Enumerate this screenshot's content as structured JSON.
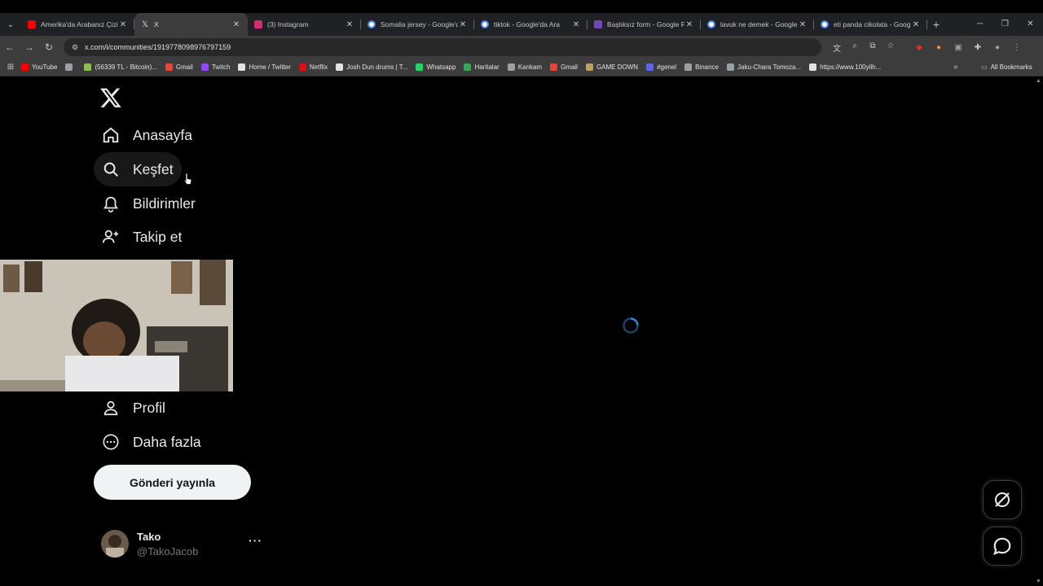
{
  "browser": {
    "tabs": [
      {
        "title": "Amerika'da Arabanız Çizil",
        "icon": "youtube-icon",
        "color": "#ff0000"
      },
      {
        "title": "X",
        "icon": "x-icon",
        "color": "#000000",
        "active": true
      },
      {
        "title": "(3) Instagram",
        "icon": "instagram-icon",
        "color": "#d62976"
      },
      {
        "title": "Somalia jersey - Google'd",
        "icon": "google-icon",
        "color": "#4285f4"
      },
      {
        "title": "tiktok - Google'da Ara",
        "icon": "google-icon",
        "color": "#4285f4"
      },
      {
        "title": "Başlıksız form - Google F",
        "icon": "forms-icon",
        "color": "#7248b9"
      },
      {
        "title": "lavuk ne demek - Google",
        "icon": "google-icon",
        "color": "#4285f4"
      },
      {
        "title": "eti panda cikolata - Goog",
        "icon": "google-icon",
        "color": "#4285f4"
      }
    ],
    "url": "x.com/i/communities/1919778098976797159",
    "bookmarks": [
      {
        "label": "YouTube",
        "color": "#ff0000"
      },
      {
        "label": "",
        "color": "#9aa0a6"
      },
      {
        "label": "(56339 TL - Bitcoin)...",
        "color": "#8bc34a"
      },
      {
        "label": "Gmail",
        "color": "#ea4335"
      },
      {
        "label": "Twitch",
        "color": "#9146ff"
      },
      {
        "label": "Home / Twitter",
        "color": "#e3e3e3"
      },
      {
        "label": "Netflix",
        "color": "#e50914"
      },
      {
        "label": "Josh Dun drums | T...",
        "color": "#e3e3e3"
      },
      {
        "label": "Whatsapp",
        "color": "#25d366"
      },
      {
        "label": "Haritalar",
        "color": "#34a853"
      },
      {
        "label": "Kankam",
        "color": "#9aa0a6"
      },
      {
        "label": "Gmail",
        "color": "#ea4335"
      },
      {
        "label": "GAME DOWN",
        "color": "#c0a060"
      },
      {
        "label": "#genel",
        "color": "#5865f2"
      },
      {
        "label": "Binance",
        "color": "#9aa0a6"
      },
      {
        "label": "Jaku-Chara Tomoza...",
        "color": "#9aa0a6"
      },
      {
        "label": "https://www.100yilh...",
        "color": "#e3e3e3"
      }
    ],
    "all_bookmarks": "All Bookmarks"
  },
  "sidebar": {
    "logo": "x-logo-icon",
    "items": [
      {
        "label": "Anasayfa",
        "icon": "home-icon"
      },
      {
        "label": "Keşfet",
        "icon": "search-icon"
      },
      {
        "label": "Bildirimler",
        "icon": "bell-icon"
      },
      {
        "label": "Takip et",
        "icon": "follow-icon"
      },
      {
        "label": "Profil",
        "icon": "profile-icon"
      },
      {
        "label": "Daha fazla",
        "icon": "more-circle-icon"
      }
    ],
    "post_button": "Gönderi yayınla",
    "account": {
      "name": "Tako",
      "handle": "@TakoJacob"
    }
  },
  "colors": {
    "accent": "#1d9bf0",
    "background": "#000000"
  }
}
